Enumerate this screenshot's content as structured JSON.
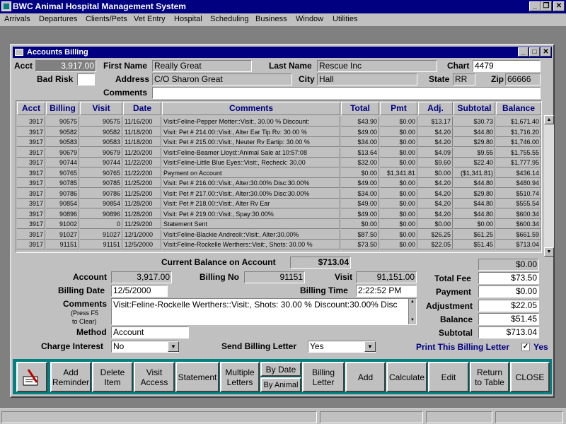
{
  "app": {
    "title": "BWC Animal Hospital Management System"
  },
  "menu": [
    "Arrivals",
    "Departures",
    "Clients/Pets",
    "Vet Entry",
    "Hospital",
    "Scheduling",
    "Business",
    "Window",
    "Utilities"
  ],
  "window": {
    "title": "Accounts Billing"
  },
  "header": {
    "acct_label": "Acct",
    "acct_value": "3,917.00",
    "first_name_label": "First Name",
    "first_name_value": "Really Great",
    "last_name_label": "Last Name",
    "last_name_value": "Rescue Inc",
    "chart_label": "Chart",
    "chart_value": "4479",
    "bad_risk_label": "Bad Risk",
    "bad_risk_value": "",
    "address_label": "Address",
    "address_value": "C/O Sharon Great",
    "city_label": "City",
    "city_value": "Hall",
    "state_label": "State",
    "state_value": "RR",
    "zip_label": "Zip",
    "zip_value": "66666",
    "comments_label": "Comments",
    "comments_value": ""
  },
  "grid": {
    "columns": [
      "Acct",
      "Billing",
      "Visit",
      "Date",
      "Comments",
      "Total",
      "Pmt",
      "Adj.",
      "Subtotal",
      "Balance"
    ],
    "rows": [
      [
        "3917",
        "90575",
        "90575",
        "11/16/200",
        "Visit:Feline-Pepper Motter::Visit:, 30.00 % Discount:",
        "$43.90",
        "$0.00",
        "$13.17",
        "$30.73",
        "$1,671.40"
      ],
      [
        "3917",
        "90582",
        "90582",
        "11/18/200",
        "Visit: Pet # 214.00::Visit:, Alter Ear Tip Rv: 30.00 %",
        "$49.00",
        "$0.00",
        "$4.20",
        "$44.80",
        "$1,716.20"
      ],
      [
        "3917",
        "90583",
        "90583",
        "11/18/200",
        "Visit: Pet # 215.00::Visit:, Neuter Rv Eartip: 30.00 %",
        "$34.00",
        "$0.00",
        "$4.20",
        "$29.80",
        "$1,746.00"
      ],
      [
        "3917",
        "90679",
        "90679",
        "11/20/200",
        "Visit:Feline-Beamer Lloyd::Animal Sale at 10:57:08",
        "$13.64",
        "$0.00",
        "$4.09",
        "$9.55",
        "$1,755.55"
      ],
      [
        "3917",
        "90744",
        "90744",
        "11/22/200",
        "Visit:Feline-Little Blue Eyes::Visit:, Recheck: 30.00",
        "$32.00",
        "$0.00",
        "$9.60",
        "$22.40",
        "$1,777.95"
      ],
      [
        "3917",
        "90765",
        "90765",
        "11/22/200",
        "Payment on Account",
        "$0.00",
        "$1,341.81",
        "$0.00",
        "($1,341.81)",
        "$436.14"
      ],
      [
        "3917",
        "90785",
        "90785",
        "11/25/200",
        "Visit: Pet # 216.00::Visit:, Alter:30.00% Disc:30.00%",
        "$49.00",
        "$0.00",
        "$4.20",
        "$44.80",
        "$480.94"
      ],
      [
        "3917",
        "90786",
        "90786",
        "11/25/200",
        "Visit: Pet # 217.00::Visit:, Alter:30.00% Disc:30.00%",
        "$34.00",
        "$0.00",
        "$4.20",
        "$29.80",
        "$510.74"
      ],
      [
        "3917",
        "90854",
        "90854",
        "11/28/200",
        "Visit: Pet # 218.00::Visit:, Alter Rv Ear",
        "$49.00",
        "$0.00",
        "$4.20",
        "$44.80",
        "$555.54"
      ],
      [
        "3917",
        "90896",
        "90896",
        "11/28/200",
        "Visit: Pet # 219.00::Visit:, Spay:30.00%",
        "$49.00",
        "$0.00",
        "$4.20",
        "$44.80",
        "$600.34"
      ],
      [
        "3917",
        "91002",
        "0",
        "11/29/200",
        "Statement Sent",
        "$0.00",
        "$0.00",
        "$0.00",
        "$0.00",
        "$600.34"
      ],
      [
        "3917",
        "91027",
        "91027",
        "12/1/2000",
        "Visit:Feline-Blackie Andreoli::Visit:, Alter:30.00%",
        "$87.50",
        "$0.00",
        "$26.25",
        "$61.25",
        "$661.59"
      ],
      [
        "3917",
        "91151",
        "91151",
        "12/5/2000",
        "Visit:Feline-Rockelle Werthers::Visit:, Shots: 30.00 %",
        "$73.50",
        "$0.00",
        "$22.05",
        "$51.45",
        "$713.04"
      ]
    ]
  },
  "detail": {
    "current_balance_label": "Current Balance on Account",
    "current_balance_value": "$713.04",
    "extra_value": "$0.00",
    "account_label": "Account",
    "account_value": "3,917.00",
    "billing_no_label": "Billing No",
    "billing_no_value": "91151",
    "visit_label": "Visit",
    "visit_value": "91,151.00",
    "billing_date_label": "Billing Date",
    "billing_date_value": "12/5/2000",
    "billing_time_label": "Billing Time",
    "billing_time_value": "2:22:52 PM",
    "comments_label": "Comments",
    "comments_hint1": "(Press F5",
    "comments_hint2": "to Clear)",
    "comments_value": "Visit:Feline-Rockelle Werthers::Visit:, Shots: 30.00 % Discount:30.00% Disc",
    "method_label": "Method",
    "method_value": "Account",
    "charge_interest_label": "Charge Interest",
    "charge_interest_value": "No",
    "send_billing_letter_label": "Send Billing Letter",
    "send_billing_letter_value": "Yes",
    "print_letter_label": "Print This Billing Letter",
    "print_letter_check": "✓",
    "print_letter_yes": "Yes",
    "total_fee_label": "Total Fee",
    "total_fee_value": "$73.50",
    "payment_label": "Payment",
    "payment_value": "$0.00",
    "adjustment_label": "Adjustment",
    "adjustment_value": "$22.05",
    "balance_label": "Balance",
    "balance_value": "$51.45",
    "subtotal_label": "Subtotal",
    "subtotal_value": "$713.04"
  },
  "toolbar": {
    "add_reminder": "Add\nReminder",
    "delete_item": "Delete\nItem",
    "visit_access": "Visit\nAccess",
    "statement": "Statement",
    "multiple_letters": "Multiple\nLetters",
    "by_date": "By Date",
    "by_animal": "By Animal",
    "billing_letter": "Billing\nLetter",
    "add": "Add",
    "calculate": "Calculate",
    "edit": "Edit",
    "return_to_table": "Return\nto Table",
    "close": "CLOSE"
  },
  "colors": {
    "title_bar": "#000080",
    "toolbar": "#008080",
    "label_blue": "#000080"
  }
}
